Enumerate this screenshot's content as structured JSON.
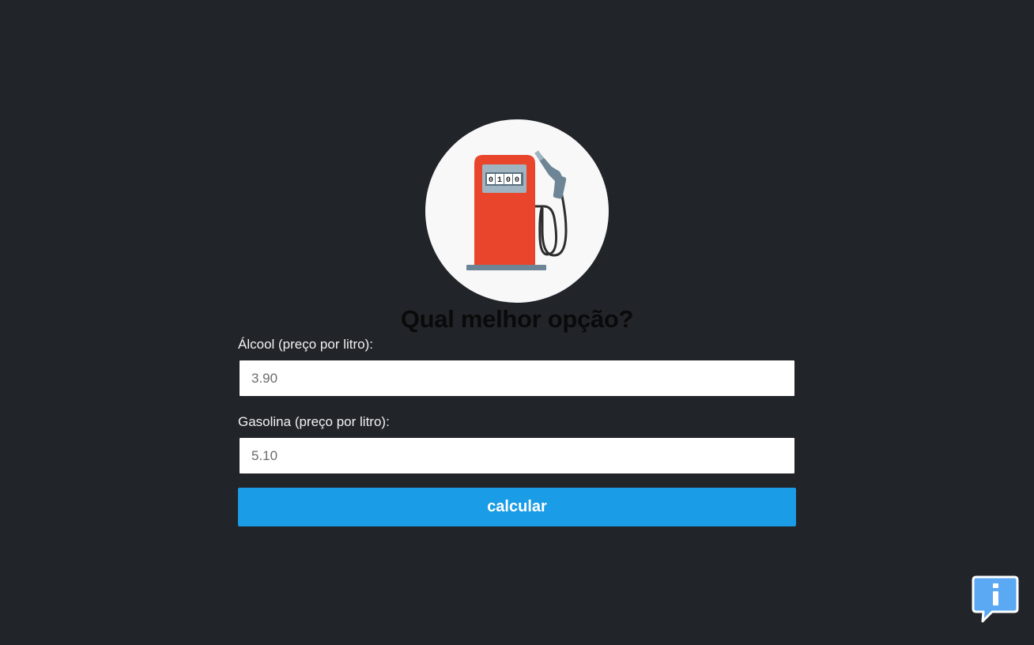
{
  "page": {
    "title": "Qual melhor opção?",
    "background_color": "#212429"
  },
  "logo": {
    "icon": "gas-pump-icon",
    "counter_display": "0100",
    "pump_color": "#e8452c",
    "circle_color": "#f8f8f8"
  },
  "form": {
    "alcool": {
      "label": "Álcool (preço por litro):",
      "value": "3.90"
    },
    "gasolina": {
      "label": "Gasolina (preço por litro):",
      "value": "5.10"
    },
    "submit_label": "calcular",
    "submit_color": "#1a9ce6"
  },
  "info_button": {
    "icon": "info-speech-bubble-icon",
    "color": "#5aa9f2"
  }
}
